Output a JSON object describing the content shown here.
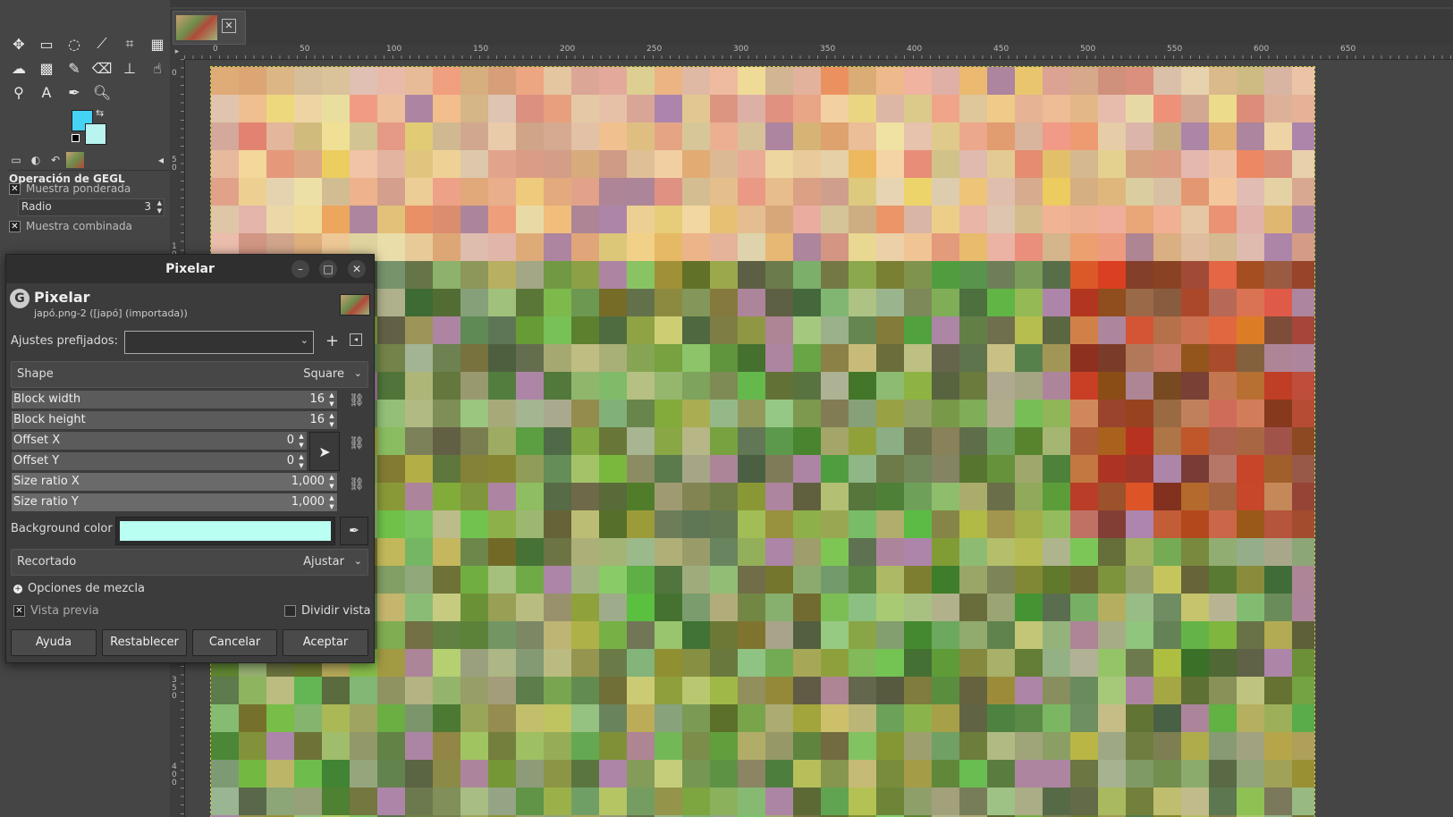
{
  "toolbox": {
    "tools": [
      {
        "name": "move-tool-icon",
        "glyph": "✥"
      },
      {
        "name": "rect-select-tool-icon",
        "glyph": "▭"
      },
      {
        "name": "lasso-tool-icon",
        "glyph": "◌"
      },
      {
        "name": "fuzzy-select-tool-icon",
        "glyph": "⟋"
      },
      {
        "name": "crop-tool-icon",
        "glyph": "⌗"
      },
      {
        "name": "unified-transform-tool-icon",
        "glyph": "▦"
      },
      {
        "name": "warp-tool-icon",
        "glyph": "☁"
      },
      {
        "name": "gradient-tool-icon",
        "glyph": "▩"
      },
      {
        "name": "paintbrush-tool-icon",
        "glyph": "✎"
      },
      {
        "name": "eraser-tool-icon",
        "glyph": "⌫"
      },
      {
        "name": "clone-tool-icon",
        "glyph": "⊥"
      },
      {
        "name": "smudge-tool-icon",
        "glyph": "☝"
      },
      {
        "name": "paths-tool-icon",
        "glyph": "⚲"
      },
      {
        "name": "text-tool-icon",
        "glyph": "A"
      },
      {
        "name": "color-picker-tool-icon",
        "glyph": "✒"
      },
      {
        "name": "zoom-tool-icon",
        "glyph": "🔍︎"
      }
    ],
    "colors": {
      "foreground": "#44d2f5",
      "background": "#b9f4f0"
    }
  },
  "tool_options": {
    "title": "Operación de GEGL",
    "weighted_sample": "Muestra ponderada",
    "radius_label": "Radio",
    "radius_value": "3",
    "merged_sample": "Muestra combinada"
  },
  "image_tab": {
    "close_glyph": "✕"
  },
  "rulers": {
    "h_ticks": [
      "0",
      "50",
      "100",
      "150",
      "200",
      "250",
      "300",
      "350",
      "400",
      "450",
      "500",
      "550",
      "600",
      "650"
    ],
    "v_ticks": [
      "0",
      "50",
      "100",
      "150",
      "200",
      "250",
      "300",
      "350",
      "400"
    ]
  },
  "dialog": {
    "title": "Pixelar",
    "op_title": "Pixelar",
    "op_subtitle": "japó.png-2 ([japó] (importada))",
    "presets_label": "Ajustes prefijados:",
    "shape_label": "Shape",
    "shape_value": "Square",
    "block_width_label": "Block width",
    "block_width_value": "16",
    "block_height_label": "Block height",
    "block_height_value": "16",
    "offset_x_label": "Offset X",
    "offset_x_value": "0",
    "offset_y_label": "Offset Y",
    "offset_y_value": "0",
    "size_ratio_x_label": "Size ratio X",
    "size_ratio_x_value": "1,000",
    "size_ratio_y_label": "Size ratio Y",
    "size_ratio_y_value": "1,000",
    "background_label": "Background color",
    "background_color": "#b9fff2",
    "clipping_label": "Recortado",
    "clipping_value": "Ajustar",
    "blend_label": "Opciones de mezcla",
    "preview_label": "Vista previa",
    "split_label": "Dividir vista",
    "buttons": {
      "help": "Ayuda",
      "reset": "Restablecer",
      "cancel": "Cancelar",
      "ok": "Aceptar"
    }
  }
}
